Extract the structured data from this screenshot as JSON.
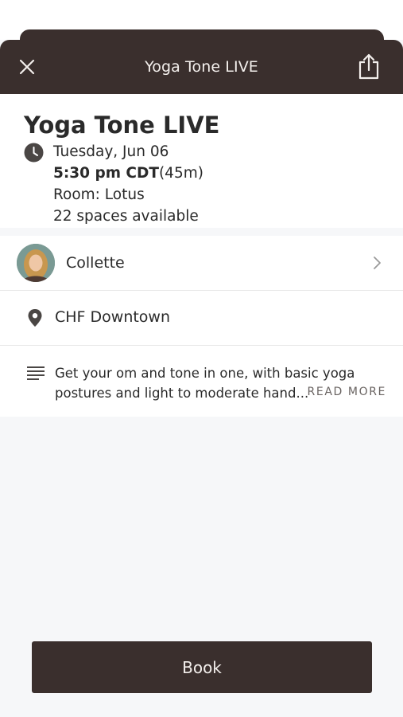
{
  "header": {
    "title": "Yoga Tone LIVE",
    "close_icon": "close-icon",
    "share_icon": "share-icon"
  },
  "class": {
    "title": "Yoga Tone LIVE",
    "date": "Tuesday, Jun 06",
    "time": "5:30 pm CDT",
    "duration": "(45m)",
    "room": "Room: Lotus",
    "spaces": "22 spaces available"
  },
  "instructor": {
    "name": "Collette"
  },
  "location": {
    "name": "CHF Downtown"
  },
  "description": {
    "text": "Get your om and tone in one, with basic yoga postures and light to moderate hand...",
    "read_more": "READ MORE"
  },
  "actions": {
    "book_label": "Book"
  },
  "colors": {
    "brand_dark": "#3a2f2d",
    "background": "#f6f7f9",
    "text": "#2a2a2a"
  }
}
